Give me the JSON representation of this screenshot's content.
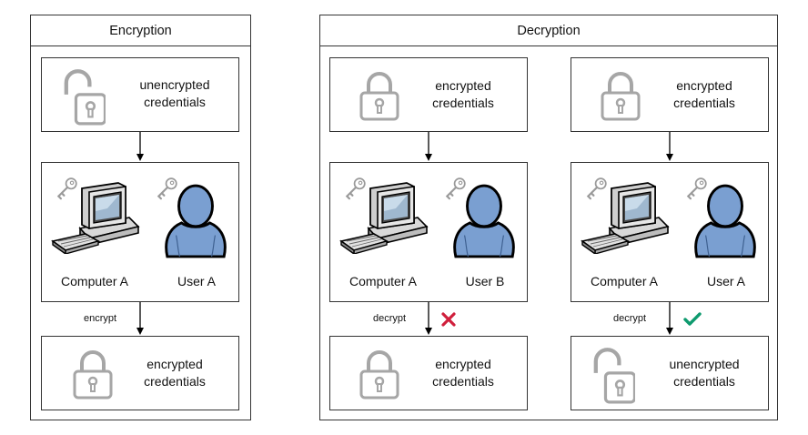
{
  "encryption": {
    "title": "Encryption",
    "top_box": {
      "line1": "unencrypted",
      "line2": "credentials",
      "icon": "unlocked-padlock-icon"
    },
    "middle_box": {
      "computer_label": "Computer A",
      "user_label": "User A"
    },
    "arrow_label": "encrypt",
    "bottom_box": {
      "line1": "encrypted",
      "line2": "credentials",
      "icon": "locked-padlock-icon"
    }
  },
  "decryption": {
    "title": "Decryption",
    "left": {
      "top_box": {
        "line1": "encrypted",
        "line2": "credentials"
      },
      "middle_box": {
        "computer_label": "Computer A",
        "user_label": "User B"
      },
      "arrow_label": "decrypt",
      "result_icon": "red-x-icon",
      "bottom_box": {
        "line1": "encrypted",
        "line2": "credentials"
      }
    },
    "right": {
      "top_box": {
        "line1": "encrypted",
        "line2": "credentials"
      },
      "middle_box": {
        "computer_label": "Computer A",
        "user_label": "User A"
      },
      "arrow_label": "decrypt",
      "result_icon": "green-check-icon",
      "bottom_box": {
        "line1": "unencrypted",
        "line2": "credentials"
      }
    }
  },
  "colors": {
    "user_fill": "#7a9fd1",
    "x_mark": "#d01f3c",
    "check_mark": "#0e9a6e",
    "icon_gray": "#a6a6a6"
  }
}
